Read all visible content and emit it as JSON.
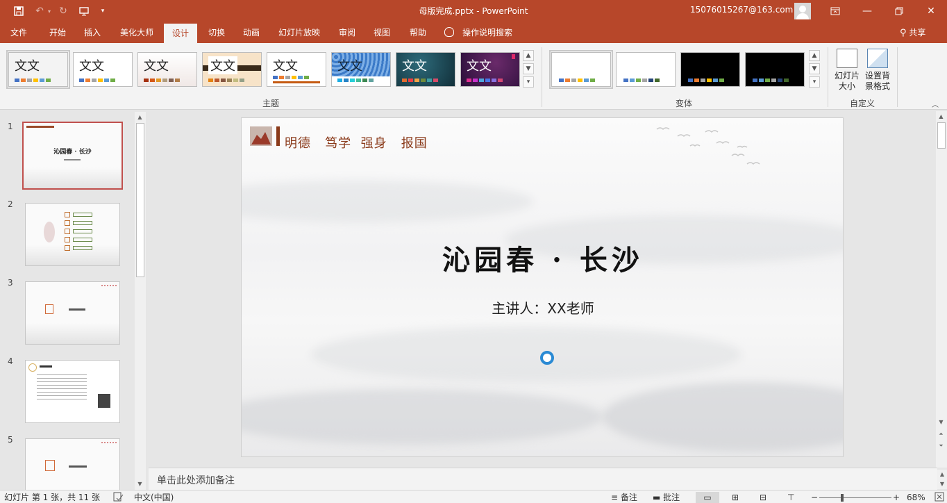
{
  "window": {
    "title": "母版完成.pptx  -  PowerPoint",
    "account": "15076015267@163.com"
  },
  "tabs": [
    {
      "label": "文件",
      "active": false
    },
    {
      "label": "开始",
      "active": false
    },
    {
      "label": "插入",
      "active": false
    },
    {
      "label": "美化大师",
      "active": false
    },
    {
      "label": "设计",
      "active": true
    },
    {
      "label": "切换",
      "active": false
    },
    {
      "label": "动画",
      "active": false
    },
    {
      "label": "幻灯片放映",
      "active": false
    },
    {
      "label": "审阅",
      "active": false
    },
    {
      "label": "视图",
      "active": false
    },
    {
      "label": "帮助",
      "active": false
    }
  ],
  "tell_me": "操作说明搜索",
  "share": "共享",
  "ribbon": {
    "themes_group": "主题",
    "variants_group": "变体",
    "customize_group": "自定义",
    "theme_sample_text": "文文",
    "slide_size": "幻灯片大小",
    "format_background": "设置背景格式"
  },
  "slides": [
    {
      "number": "1",
      "title": "沁园春 · 长沙"
    },
    {
      "number": "2",
      "title": ""
    },
    {
      "number": "3",
      "title": ""
    },
    {
      "number": "4",
      "title": ""
    },
    {
      "number": "5",
      "title": ""
    }
  ],
  "current_slide": {
    "motto": "明德   笃学  强身   报国",
    "title": "沁园春 · 长沙",
    "subtitle": "主讲人：XX老师"
  },
  "notes_placeholder": "单击此处添加备注",
  "status": {
    "slide_position": "幻灯片 第 1 张，共 11 张",
    "language": "中文(中国)",
    "notes": "备注",
    "comments": "批注",
    "zoom": "68%"
  },
  "colors": {
    "accent": "#b7472a",
    "selected_thumb_border": "#c0504d",
    "motto": "#8a3a1a"
  }
}
